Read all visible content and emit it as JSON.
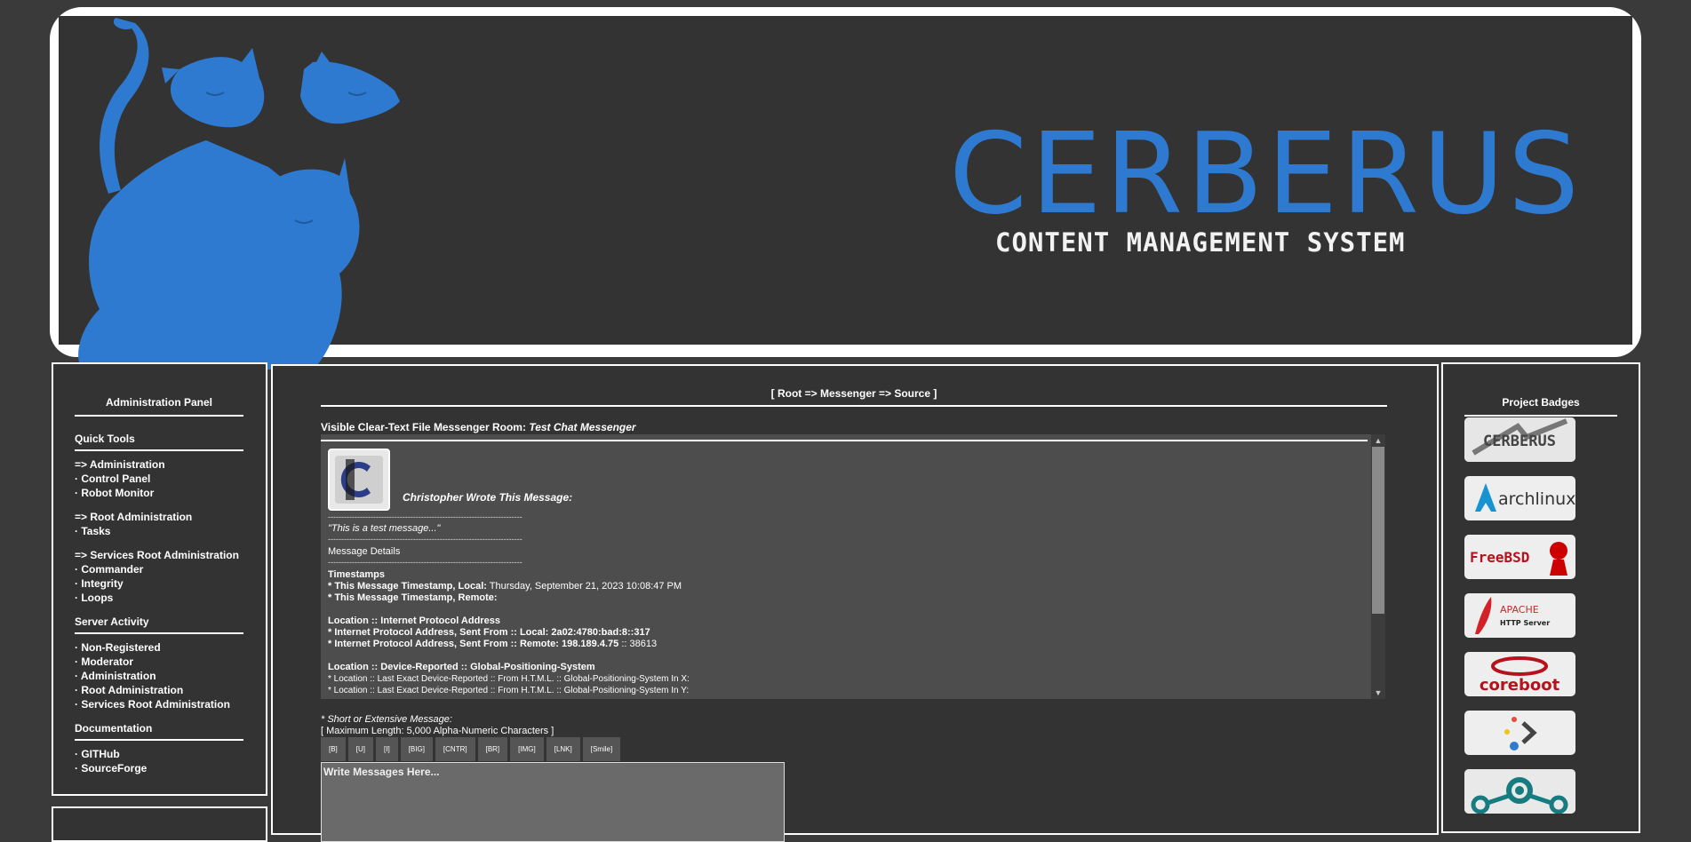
{
  "banner": {
    "title": "CERBERUS",
    "subtitle": "CONTENT MANAGEMENT SYSTEM"
  },
  "colors": {
    "brand_blue": "#2f7ad1",
    "panel_bg": "#333333",
    "page_bg": "#3a3a3a"
  },
  "left_panel": {
    "title": "Administration Panel",
    "quick_tools": "Quick Tools",
    "items_admin": [
      "=> Administration",
      "· Control Panel",
      "· Robot Monitor"
    ],
    "items_root": [
      "=> Root Administration",
      "· Tasks"
    ],
    "items_services": [
      "=> Services Root Administration",
      "· Commander",
      "· Integrity",
      "· Loops"
    ],
    "server_activity": "Server Activity",
    "activity_items": [
      "· Non-Registered",
      "· Moderator",
      "· Administration",
      "· Root Administration",
      "· Services Root Administration"
    ],
    "documentation": "Documentation",
    "doc_items": [
      "· GITHub",
      "· SourceForge"
    ]
  },
  "center": {
    "breadcrumb": "[ Root => Messenger => Source ]",
    "room_label": "Visible Clear-Text File Messenger Room:",
    "room_name": "Test Chat Messenger",
    "message": {
      "author_line": "Christopher Wrote This Message:",
      "dashes": "-------------------------------------------------------------------------",
      "text": "\"This is a test message...\"",
      "details": "Message Details",
      "timestamps_head": "Timestamps",
      "ts_local_label": "* This Message Timestamp, Local:",
      "ts_local_value": "Thursday, September 21, 2023 10:08:47 PM",
      "ts_remote_label": "* This Message Timestamp, Remote:",
      "ip_head": "Location :: Internet Protocol Address",
      "ip_local": "* Internet Protocol Address, Sent From :: Local: 2a02:4780:bad:8::317",
      "ip_remote_label": "* Internet Protocol Address, Sent From :: Remote: 198.189.4.75",
      "ip_remote_port": ":: 38613",
      "gps_head": "Location :: Device-Reported :: Global-Positioning-System",
      "gps_x": "* Location :: Last Exact Device-Reported :: From H.T.M.L. :: Global-Positioning-System In X:",
      "gps_y": "* Location :: Last Exact Device-Reported :: From H.T.M.L. :: Global-Positioning-System In Y:"
    },
    "prompt_line1": "* Short or Extensive Message:",
    "prompt_line2": "[ Maximum Length: 5,000 Alpha-Numeric Characters ]",
    "toolbar": [
      "[B]",
      "[U]",
      "[I]",
      "[BIG]",
      "[CNTR]",
      "[BR]",
      "[IMG]",
      "[LNK]",
      "[Smile]"
    ],
    "compose_placeholder": "Write Messages Here..."
  },
  "right_panel": {
    "title": "Project Badges",
    "badges": [
      {
        "label": "CERBERUS",
        "icon": "cerberus-badge-icon"
      },
      {
        "label": "archlinux",
        "icon": "arch-logo-icon"
      },
      {
        "label": "FreeBSD",
        "icon": "freebsd-daemon-icon"
      },
      {
        "label": "APACHE",
        "sub": "HTTP Server",
        "icon": "apache-feather-icon"
      },
      {
        "label": "coreboot",
        "icon": "coreboot-rabbit-icon"
      },
      {
        "label": "",
        "icon": "prompt-chevron-icon"
      },
      {
        "label": "",
        "icon": "lineageos-icon"
      }
    ]
  }
}
